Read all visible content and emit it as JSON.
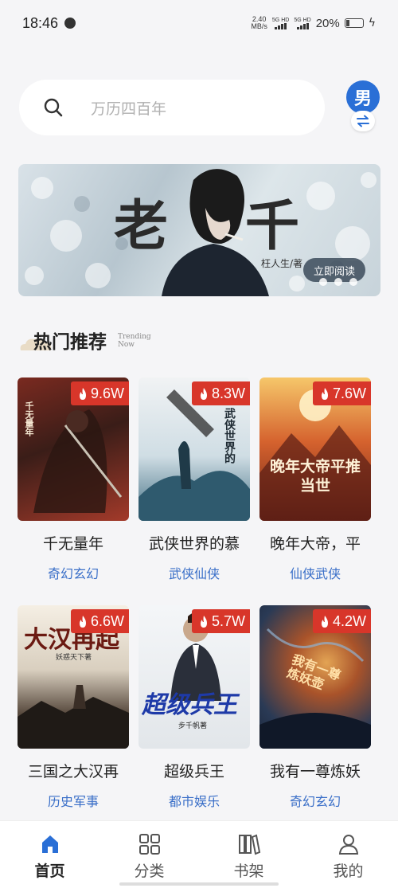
{
  "status": {
    "time": "18:46",
    "speed_value": "2.40",
    "speed_unit": "MB/s",
    "sim1": "5G HD",
    "sim2": "5G HD",
    "battery": "20%"
  },
  "search": {
    "placeholder": "万历四百年"
  },
  "gender": {
    "label": "男"
  },
  "banner": {
    "title_left": "老",
    "title_right": "千",
    "author": "枉人生/著",
    "read_button": "立即阅读"
  },
  "section": {
    "title": "热门推荐",
    "subtitle_line1": "Trending",
    "subtitle_line2": "Now"
  },
  "books": [
    {
      "name": "千无量年",
      "genre": "奇幻玄幻",
      "hot": "9.6W",
      "cover_colors": [
        "#6b1f1a",
        "#2c1a17",
        "#a33a2a"
      ],
      "cover_text": "千无量年"
    },
    {
      "name": "武侠世界的慕",
      "genre": "武侠仙侠",
      "hot": "8.3W",
      "cover_colors": [
        "#e8ecef",
        "#2f5a6e",
        "#8fb3c4"
      ],
      "cover_text": "武侠世界的"
    },
    {
      "name": "晚年大帝，平",
      "genre": "仙侠武侠",
      "hot": "7.6W",
      "cover_colors": [
        "#f2b04a",
        "#b8431f",
        "#5a1e15"
      ],
      "cover_text": "晚年大帝平推当世"
    },
    {
      "name": "三国之大汉再",
      "genre": "历史军事",
      "hot": "6.6W",
      "cover_colors": [
        "#f3ece0",
        "#8a7d6c",
        "#2b2520"
      ],
      "cover_text": "大汉再起"
    },
    {
      "name": "超级兵王",
      "genre": "都市娱乐",
      "hot": "5.7W",
      "cover_colors": [
        "#eef2f5",
        "#2a2f3a",
        "#f0d64a"
      ],
      "cover_text": "超级兵王"
    },
    {
      "name": "我有一尊炼妖",
      "genre": "奇幻玄幻",
      "hot": "4.2W",
      "cover_colors": [
        "#2a3a55",
        "#c96a2b",
        "#e3a454"
      ],
      "cover_text": "我有一尊炼妖壶"
    }
  ],
  "cover_authors": [
    "妖惑天下著",
    "步千帆著"
  ],
  "nav": [
    {
      "label": "首页",
      "icon": "home-icon",
      "active": true
    },
    {
      "label": "分类",
      "icon": "category-grid-icon",
      "active": false
    },
    {
      "label": "书架",
      "icon": "bookshelf-icon",
      "active": false
    },
    {
      "label": "我的",
      "icon": "profile-icon",
      "active": false
    }
  ],
  "colors": {
    "accent": "#2a6fd6",
    "genre": "#3a6fc8",
    "hot_badge": "#d8362a"
  }
}
